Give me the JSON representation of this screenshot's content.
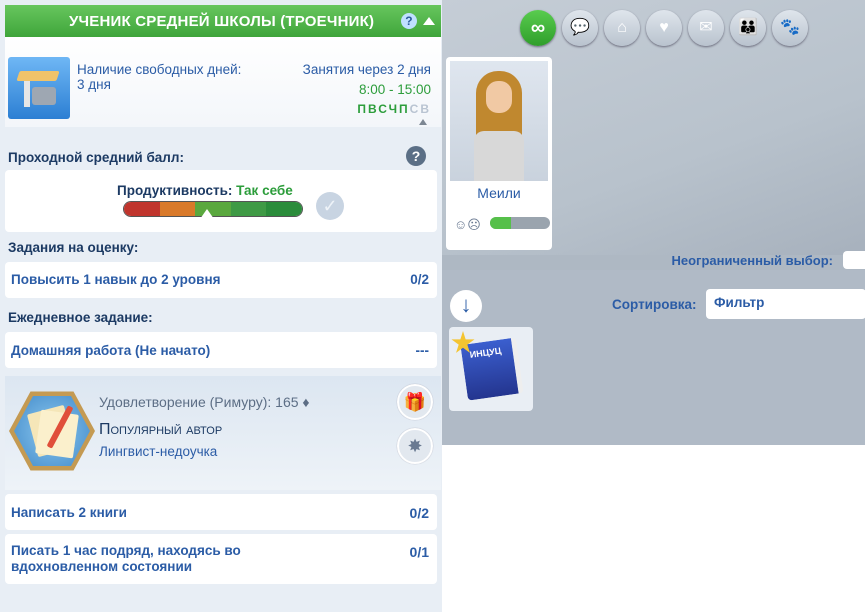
{
  "career": {
    "header": "УЧЕНИК СРЕДНЕЙ ШКОЛЫ (ТРОЕЧНИК)",
    "help": "?",
    "free_days_label": "Наличие свободных дней:",
    "free_days_value": "3 дня",
    "next_lesson": "Занятия через 2 дня",
    "hours": "8:00 - 15:00",
    "days": [
      "П",
      "В",
      "С",
      "Ч",
      "П",
      "С",
      "В"
    ],
    "days_active": [
      true,
      true,
      true,
      true,
      true,
      false,
      false
    ],
    "passing_grade_title": "Проходной средний балл:",
    "performance_label": "Продуктивность:",
    "performance_value": "Так себе",
    "performance_level": 0.5,
    "tasks_title": "Задания на оценку:",
    "task1": "Повысить 1 навык до 2 уровня",
    "task1_progress": "0/2",
    "daily_title": "Ежедневное задание:",
    "daily1": "Домашняя работа (Не начато)",
    "daily1_progress": "---"
  },
  "aspiration": {
    "satisfaction": "Удовлетворение (Римуру): 165",
    "title": "Популярный автор",
    "subtitle": "Лингвист-недоучка",
    "goal1": "Написать 2 книги",
    "goal1_progress": "0/2",
    "goal2_line1": "Писать 1 час подряд, находясь во",
    "goal2_line2": "вдохновленном состоянии",
    "goal2_progress": "0/1"
  },
  "rel_panel": {
    "tabs": [
      "all",
      "chat",
      "home",
      "heart",
      "briefcase",
      "group",
      "paw"
    ],
    "active_tab": "all",
    "active_tab_glyph": "∞",
    "sim_name": "Меили",
    "unlimited_label": "Неограниченный выбор:",
    "sort_label": "Сортировка:",
    "filter_value": "Фильтр",
    "need_level": 0.35
  },
  "colors": {
    "accent_green": "#3fa53a",
    "text_blue": "#2b5ca6",
    "dark_title": "#1c3a63"
  }
}
